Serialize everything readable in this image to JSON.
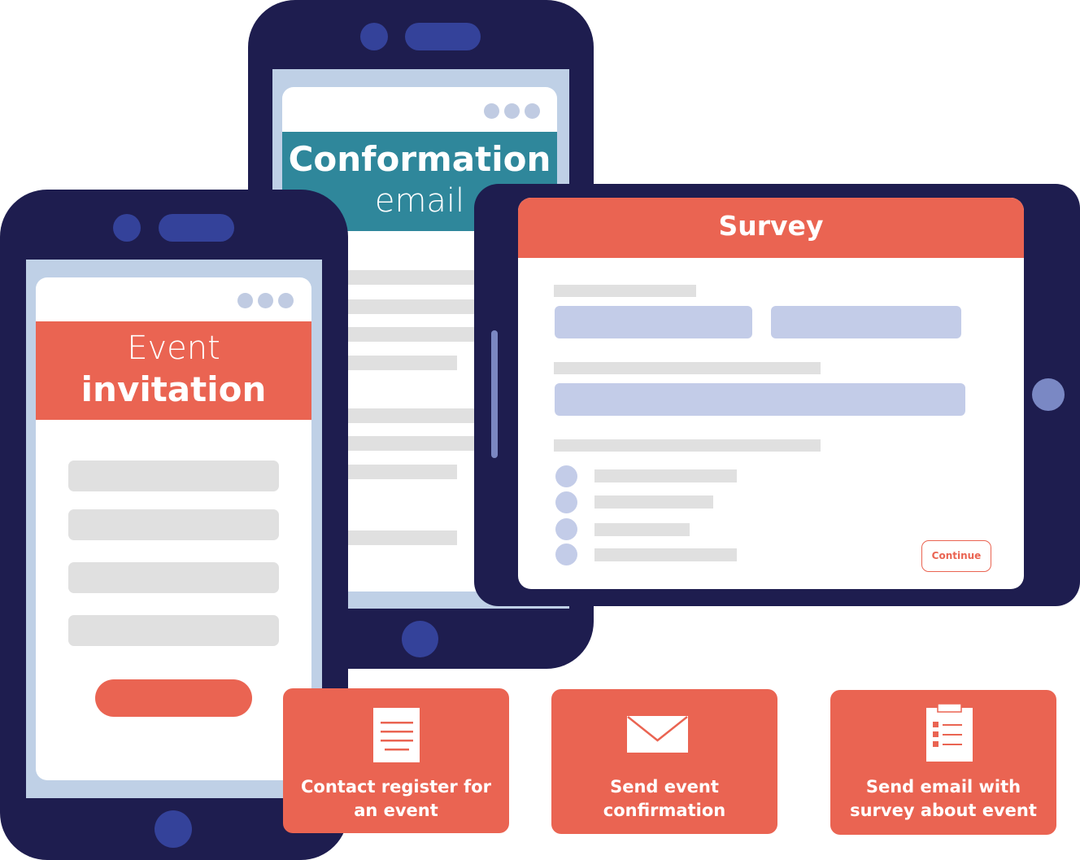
{
  "illustration": {
    "phone_mid": {
      "header_line1": "Conformation",
      "header_line2": "email",
      "header_color": "#2f879b"
    },
    "phone_left": {
      "header_line1": "Event",
      "header_line2": "invitation",
      "header_color": "#ea6452"
    },
    "tablet": {
      "title": "Survey",
      "header_color": "#ea6452",
      "continue_label": "Continue"
    }
  },
  "steps": [
    {
      "icon": "document-icon",
      "label_line1": "Contact register for",
      "label_line2": "an event"
    },
    {
      "icon": "envelope-icon",
      "label_line1": "Send event",
      "label_line2": "confirmation"
    },
    {
      "icon": "clipboard-checklist-icon",
      "label_line1": "Send email with",
      "label_line2": "survey about event"
    }
  ],
  "colors": {
    "device_frame": "#1e1d4f",
    "accent_coral": "#ea6452",
    "accent_teal": "#2f879b",
    "field_blue": "#c3cce8",
    "placeholder_grey": "#e0e0e0"
  }
}
